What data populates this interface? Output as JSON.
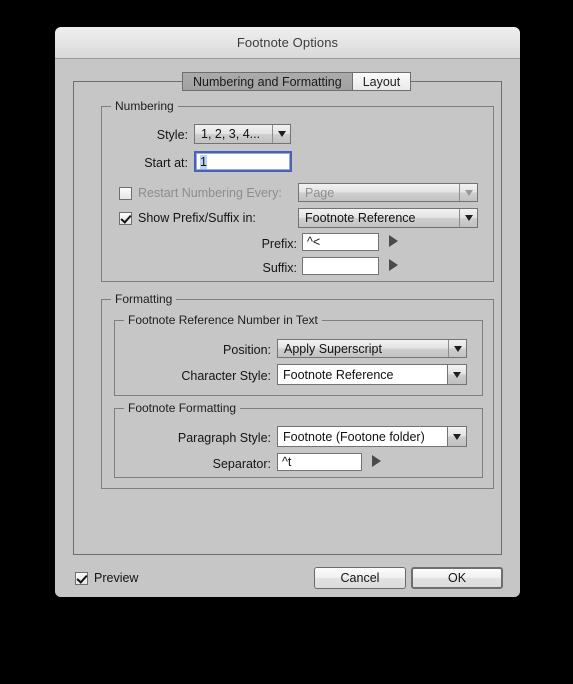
{
  "window": {
    "title": "Footnote Options"
  },
  "tabs": [
    {
      "label": "Numbering and Formatting",
      "selected": true
    },
    {
      "label": "Layout",
      "selected": false
    }
  ],
  "numbering": {
    "group_title": "Numbering",
    "style_label": "Style:",
    "style_value": "1, 2, 3, 4...",
    "start_at_label": "Start at:",
    "start_at_value": "1",
    "restart_label": "Restart Numbering Every:",
    "restart_checked": false,
    "restart_value": "Page",
    "show_prefix_label": "Show Prefix/Suffix in:",
    "show_prefix_checked": true,
    "show_prefix_value": "Footnote Reference",
    "prefix_label": "Prefix:",
    "prefix_value": "^<",
    "suffix_label": "Suffix:",
    "suffix_value": ""
  },
  "formatting": {
    "group_title": "Formatting",
    "reference_number": {
      "group_title": "Footnote Reference Number in Text",
      "position_label": "Position:",
      "position_value": "Apply Superscript",
      "character_style_label": "Character Style:",
      "character_style_value": "Footnote Reference"
    },
    "footnote_formatting": {
      "group_title": "Footnote Formatting",
      "paragraph_style_label": "Paragraph Style:",
      "paragraph_style_value": "Footnote (Footone folder)",
      "separator_label": "Separator:",
      "separator_value": "^t"
    }
  },
  "footer": {
    "preview_label": "Preview",
    "preview_checked": true,
    "cancel_label": "Cancel",
    "ok_label": "OK"
  },
  "colors": {
    "dialog_bg": "#c6c6c6",
    "titlebar_top": "#efefef",
    "titlebar_bottom": "#d9d9d9",
    "selection_highlight": "#b9d4f2",
    "focus_ring": "#4a5fb8",
    "border": "#6e6e6e"
  }
}
